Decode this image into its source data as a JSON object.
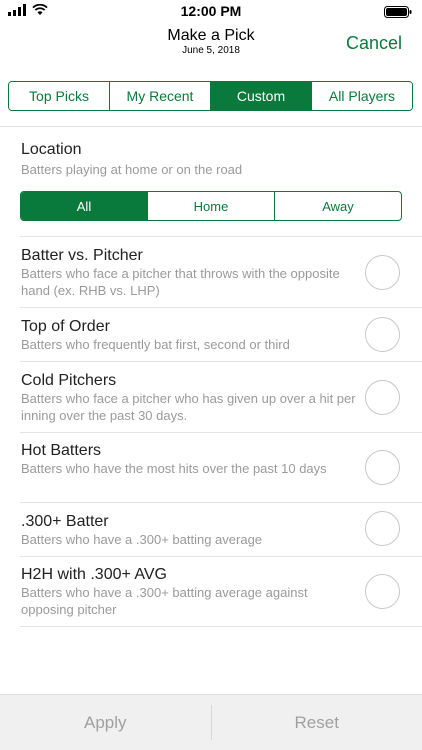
{
  "status": {
    "time": "12:00 PM"
  },
  "nav": {
    "title": "Make a Pick",
    "subtitle": "June 5, 2018",
    "cancel_label": "Cancel"
  },
  "tabs": [
    {
      "label": "Top Picks"
    },
    {
      "label": "My Recent"
    },
    {
      "label": "Custom",
      "active": true
    },
    {
      "label": "All Players"
    }
  ],
  "location": {
    "title": "Location",
    "description": "Batters playing at home or on the road",
    "segments": [
      {
        "label": "All",
        "active": true
      },
      {
        "label": "Home"
      },
      {
        "label": "Away"
      }
    ]
  },
  "options": [
    {
      "title": "Batter vs. Pitcher",
      "description": "Batters who face a pitcher that throws with the opposite hand (ex. RHB vs. LHP)",
      "selected": false
    },
    {
      "title": "Top of Order",
      "description": "Batters who frequently bat first, second or third",
      "selected": false
    },
    {
      "title": "Cold Pitchers",
      "description": "Batters who face a pitcher who has given up over a hit per inning over the past 30 days.",
      "selected": false
    },
    {
      "title": "Hot Batters",
      "description": "Batters who have the most hits over the past 10 days",
      "selected": false
    },
    {
      "title": ".300+ Batter",
      "description": "Batters who have a .300+ batting average",
      "selected": false
    },
    {
      "title": "H2H with .300+ AVG",
      "description": "Batters who have a .300+ batting average against opposing pitcher",
      "selected": false
    }
  ],
  "footer": {
    "apply_label": "Apply",
    "reset_label": "Reset"
  },
  "colors": {
    "accent": "#0a7a3c",
    "muted": "#9a9a9a"
  },
  "icons": {
    "signal": "cellular-signal-icon",
    "wifi": "wifi-icon",
    "battery": "battery-icon"
  }
}
